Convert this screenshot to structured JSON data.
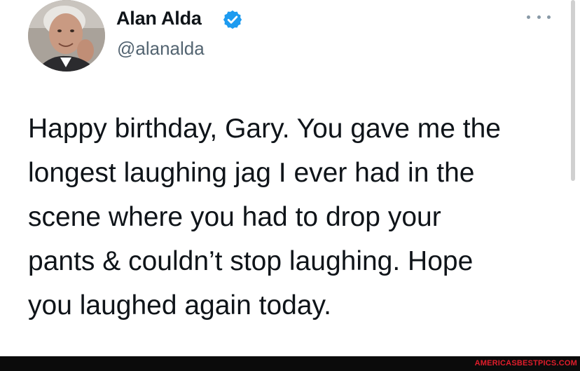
{
  "author": {
    "display_name": "Alan Alda",
    "handle": "@alanalda",
    "verified": true,
    "avatar_icon": "profile-photo-icon"
  },
  "tweet": {
    "lines": [
      "Happy birthday, Gary. You gave me the",
      "longest laughing jag I ever had in the",
      "scene where you had to drop your",
      "pants & couldn’t stop laughing.  Hope",
      "you laughed again today."
    ]
  },
  "menu": {
    "icon": "more-options-icon"
  },
  "watermark": {
    "text": "AMERICASBESTPICS.COM"
  },
  "colors": {
    "verified_blue": "#1d9bf0",
    "text": "#0f1419",
    "secondary_text": "#536471",
    "watermark": "#e11d2b"
  }
}
